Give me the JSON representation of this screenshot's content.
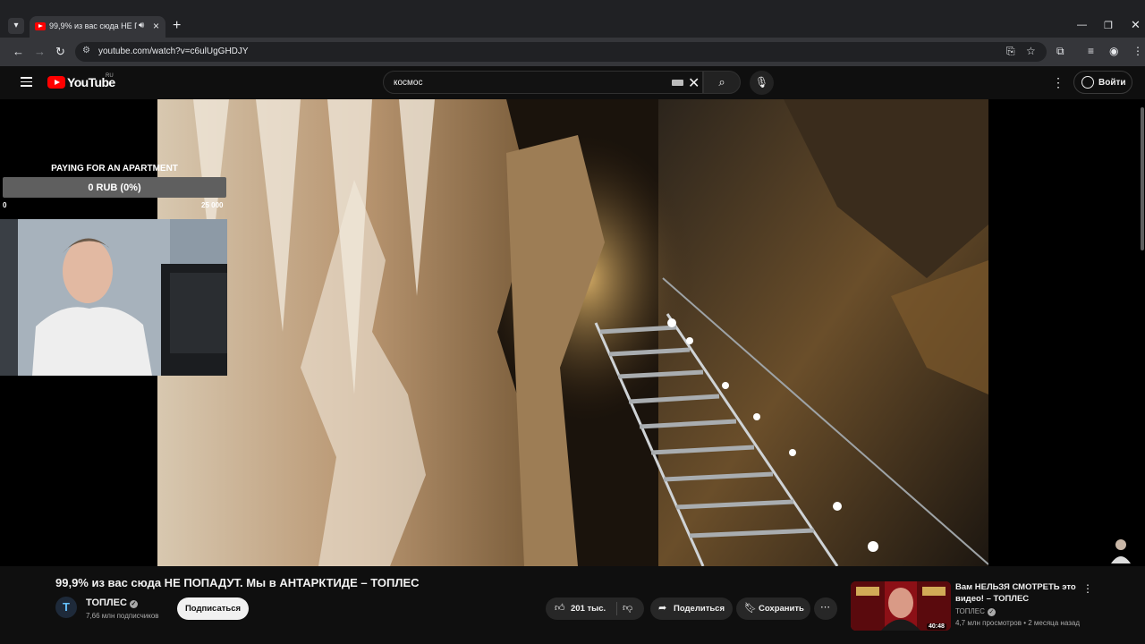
{
  "browser": {
    "tab_title": "99,9% из вас сюда НЕ ПОПАДУТ",
    "url": "youtube.com/watch?v=c6ulUgGHDJY"
  },
  "masthead": {
    "logo_text": "YouTube",
    "country_code": "RU",
    "search_value": "космос",
    "sign_in_label": "Войти"
  },
  "overlay": {
    "title": "PAYING FOR AN APARTMENT",
    "progress_label": "0 RUB (0%)",
    "progress_fraction": 0,
    "min_label": "0",
    "max_label": "25 000"
  },
  "video": {
    "title": "99,9% из вас сюда НЕ ПОПАДУТ. Мы в АНТАРКТИДЕ – ТОПЛЕС",
    "channel_name": "ТОПЛЕС",
    "channel_initial": "T",
    "subscribers": "7,66 млн подписчиков",
    "subscribe_label": "Подписаться",
    "likes": "201 тыс.",
    "share_label": "Поделиться",
    "save_label": "Сохранить"
  },
  "recommendation": {
    "title": "Вам НЕЛЬЗЯ СМОТРЕТЬ это видео! – ТОПЛЕС",
    "channel": "ТОПЛЕС",
    "meta": "4,7 млн просмотров • 2 месяца назад",
    "duration": "40:48"
  },
  "colors": {
    "youtube_red": "#ff0000",
    "background": "#0f0f0f",
    "chrome_dark": "#202124"
  }
}
